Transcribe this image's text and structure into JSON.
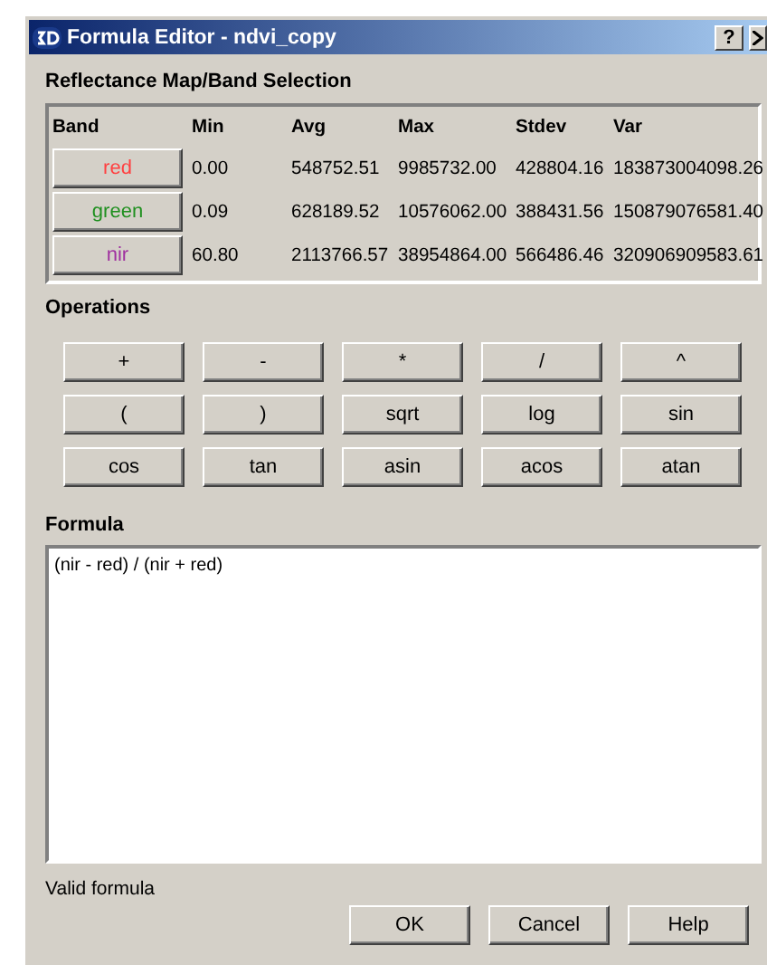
{
  "window": {
    "title": "Formula Editor - ndvi_copy",
    "help_button": "?"
  },
  "band_selection": {
    "title": "Reflectance Map/Band Selection",
    "columns": [
      "Band",
      "Min",
      "Avg",
      "Max",
      "Stdev",
      "Var"
    ],
    "rows": [
      {
        "band": "red",
        "color": "#ff4040",
        "min": "0.00",
        "avg": "548752.51",
        "max": "9985732.00",
        "stdev": "428804.16",
        "var": "183873004098.26"
      },
      {
        "band": "green",
        "color": "#209020",
        "min": "0.09",
        "avg": "628189.52",
        "max": "10576062.00",
        "stdev": "388431.56",
        "var": "150879076581.40"
      },
      {
        "band": "nir",
        "color": "#a030a0",
        "min": "60.80",
        "avg": "2113766.57",
        "max": "38954864.00",
        "stdev": "566486.46",
        "var": "320906909583.61"
      }
    ]
  },
  "operations": {
    "title": "Operations",
    "buttons": [
      "+",
      "-",
      "*",
      "/",
      "^",
      "(",
      ")",
      "sqrt",
      "log",
      "sin",
      "cos",
      "tan",
      "asin",
      "acos",
      "atan"
    ]
  },
  "formula": {
    "title": "Formula",
    "value": "(nir - red) / (nir + red)"
  },
  "status": "Valid formula",
  "buttons": [
    "OK",
    "Cancel",
    "Help"
  ]
}
